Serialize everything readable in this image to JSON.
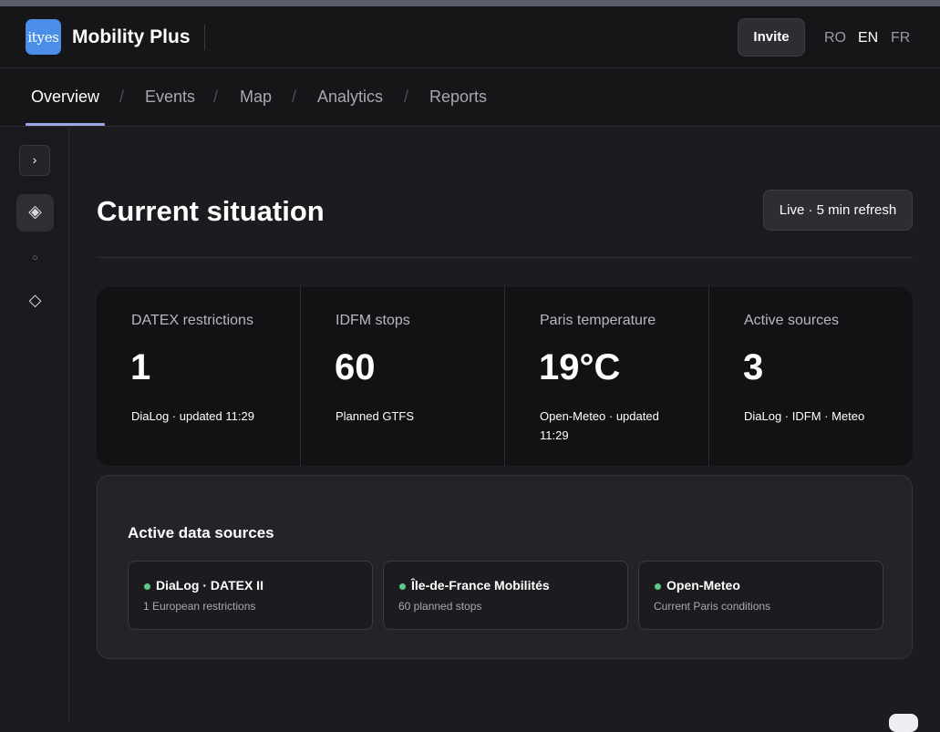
{
  "header": {
    "logo_text": "ityes",
    "app_title": "Mobility Plus",
    "invite_label": "Invite",
    "languages": [
      {
        "code": "RO",
        "active": false
      },
      {
        "code": "EN",
        "active": true
      },
      {
        "code": "FR",
        "active": false
      }
    ]
  },
  "tabs": [
    {
      "label": "Overview",
      "active": true
    },
    {
      "label": "Events",
      "active": false
    },
    {
      "label": "Map",
      "active": false
    },
    {
      "label": "Analytics",
      "active": false
    },
    {
      "label": "Reports",
      "active": false
    }
  ],
  "tab_separator": "/",
  "sidebar": {
    "toggle_icon": "chevron-right-icon",
    "toggle_glyph": "›",
    "items": [
      {
        "icon": "layers-diamond-icon",
        "glyph": "◈",
        "active": true
      },
      {
        "icon": "small-circle-icon",
        "glyph": "○",
        "active": false
      },
      {
        "icon": "diamond-outline-icon",
        "glyph": "◇",
        "active": false
      }
    ]
  },
  "main": {
    "title": "Current situation",
    "live_label": "Live · 5 min refresh"
  },
  "stats": [
    {
      "label": "DATEX restrictions",
      "value": "1",
      "sub": "DiaLog · updated 11:29"
    },
    {
      "label": "IDFM stops",
      "value": "60",
      "sub": "Planned GTFS"
    },
    {
      "label": "Paris temperature",
      "value": "19°C",
      "sub": "Open-Meteo · updated 11:29"
    },
    {
      "label": "Active sources",
      "value": "3",
      "sub": "DiaLog · IDFM · Meteo"
    }
  ],
  "sources": {
    "title": "Active data sources",
    "items": [
      {
        "name": "DiaLog · DATEX II",
        "desc": "1 European restrictions",
        "status_color": "#5fc98b"
      },
      {
        "name": "Île-de-France Mobilités",
        "desc": "60 planned stops",
        "status_color": "#5fc98b"
      },
      {
        "name": "Open-Meteo",
        "desc": "Current Paris conditions",
        "status_color": "#5fc98b"
      }
    ]
  },
  "colors": {
    "accent_underline": "#9aa6e6",
    "logo_bg": "#4a8ee8",
    "status_ok": "#5fc98b"
  }
}
